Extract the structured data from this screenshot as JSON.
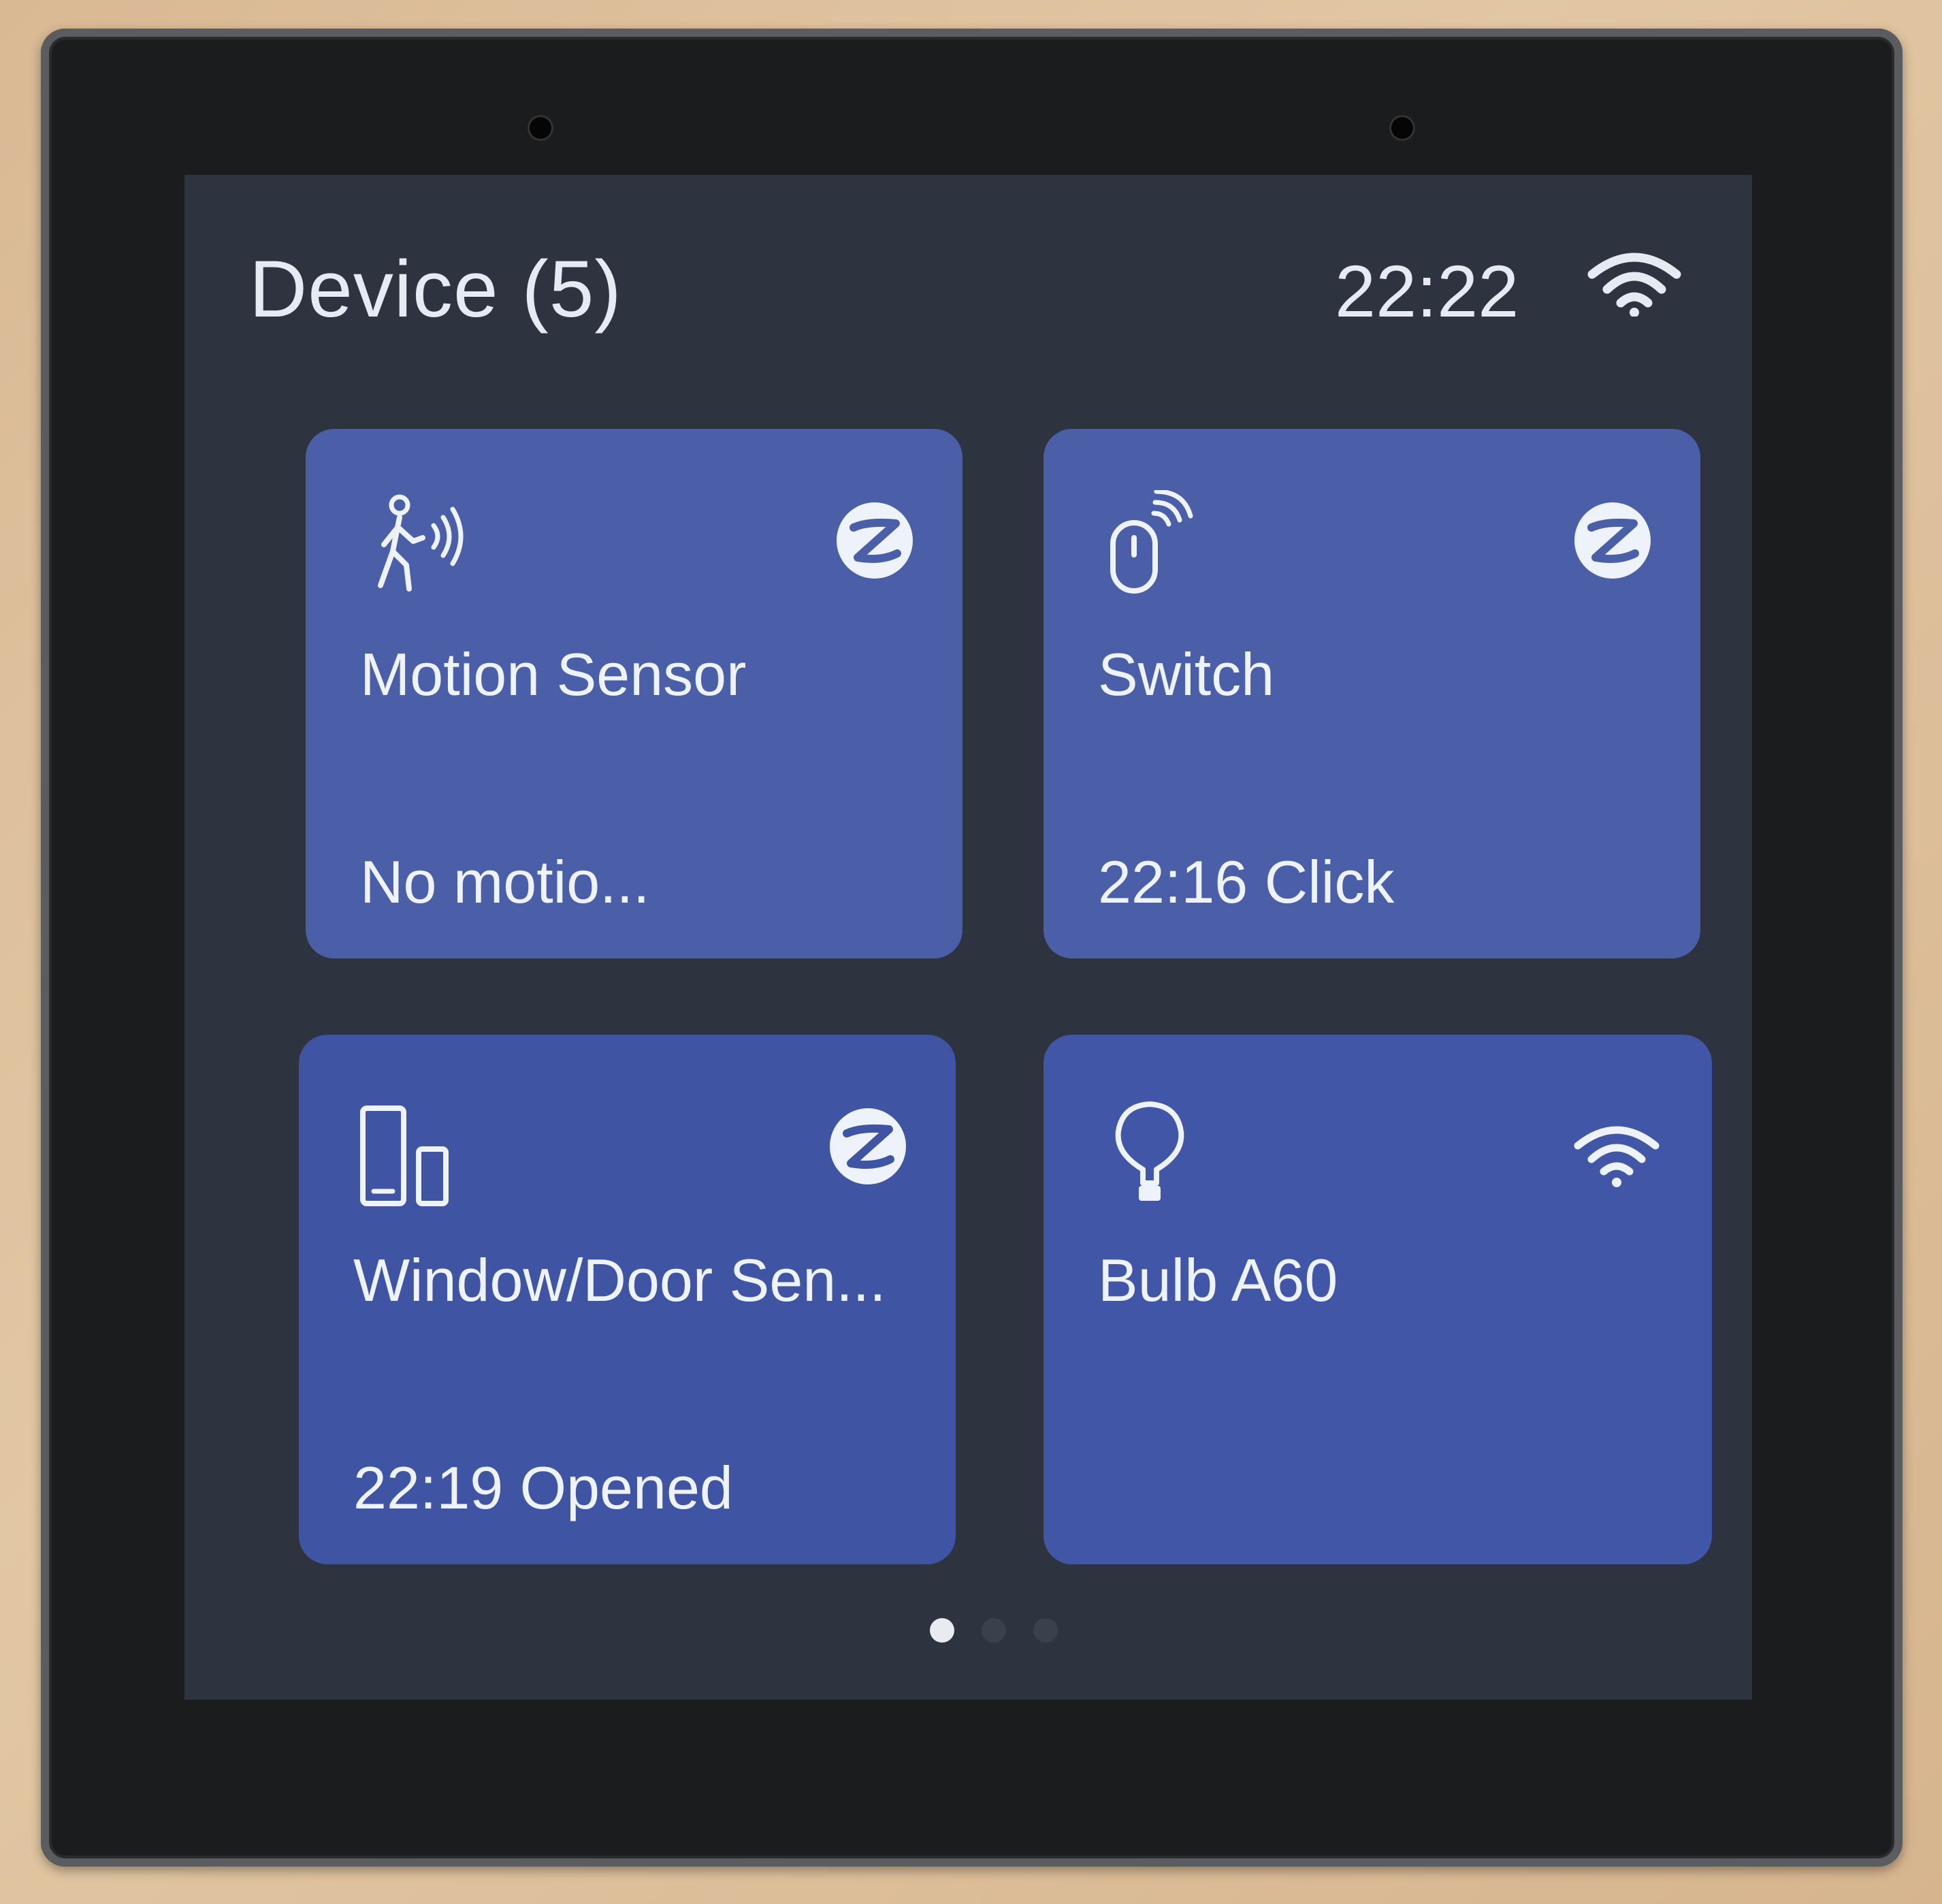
{
  "header": {
    "title": "Device (5)",
    "time": "22:22",
    "wifi_icon": "wifi-icon"
  },
  "devices": [
    {
      "name": "Motion Sensor",
      "status": "No motio...",
      "icon": "motion-sensor-icon",
      "protocol_icon": "zigbee-icon"
    },
    {
      "name": "Switch",
      "status": "22:16 Click",
      "icon": "wireless-switch-icon",
      "protocol_icon": "zigbee-icon"
    },
    {
      "name": "Window/Door Sen...",
      "status": "22:19 Opened",
      "icon": "window-door-sensor-icon",
      "protocol_icon": "zigbee-icon"
    },
    {
      "name": "Bulb A60",
      "status": "",
      "icon": "bulb-icon",
      "protocol_icon": "wifi-icon"
    }
  ],
  "pager": {
    "pages": 3,
    "active_page": 1
  },
  "colors": {
    "card": "#4a5fa8",
    "screen": "#2d343f",
    "text": "#eef2fa"
  }
}
